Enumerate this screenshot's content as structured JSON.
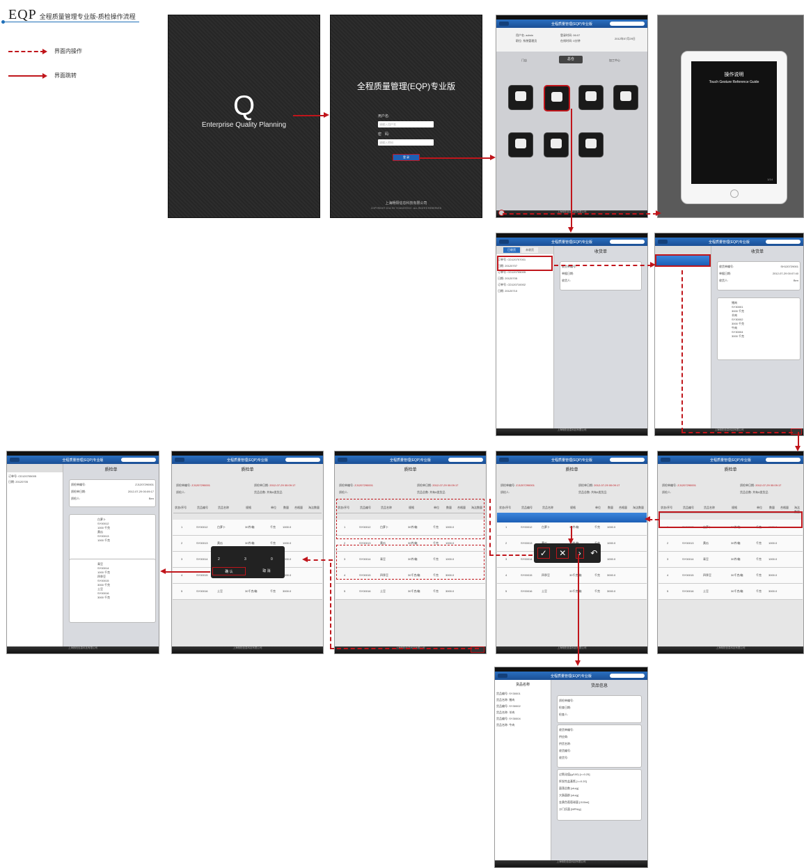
{
  "header": {
    "logo": "EQP",
    "subtitle": "全程质量管理专业版-质检操作流程"
  },
  "legend": {
    "dashed_label": "界面内操作",
    "solid_label": "界面跳转"
  },
  "splash": {
    "logo_letter": "Q",
    "product_name": "Enterprise Quality Planning"
  },
  "login": {
    "title": "全程质量管理(EQP)专业版",
    "username_label": "用户名:",
    "username_placeholder": "请输入用户名",
    "password_label": "密　码:",
    "password_placeholder": "请输入密码",
    "login_button": "登 录",
    "company": "上海畅阳信息科技有限公司",
    "copyright": "COPYRIGHT 2012 BY YOUNGTECH . ALL RIGHTS RESERVED"
  },
  "menu": {
    "nav_title": "全程质量管理(EQP)专业版",
    "user_label": "用户名: admin",
    "role_label": "职位: 系统管理员",
    "login_time": "登录时间: 06:07",
    "online_time": "在线时间: 0分钟",
    "date": "2012年07月29日",
    "tabs": [
      "门店",
      "总仓",
      "加工中心"
    ],
    "icons": [
      "收货",
      "质检",
      "入库",
      "申请退货",
      "退货处理",
      "分拣",
      "配送"
    ]
  },
  "guide": {
    "title": "操作说明",
    "subtitle": "Touch Gesture Reference Guide",
    "pager": "1/14"
  },
  "receipt": {
    "title": "收货单",
    "tab_done": "已收货",
    "tab_pending": "未收货",
    "orders": [
      {
        "no": "订单号:",
        "val": "CD120707001"
      },
      {
        "no": "日期:",
        "val": "20120707"
      },
      {
        "no": "订单号:",
        "val": "CD120705005"
      },
      {
        "no": "日期:",
        "val": "20120705"
      },
      {
        "no": "订单号:",
        "val": "CD120710002"
      },
      {
        "no": "日期:",
        "val": "20120710"
      }
    ],
    "form": [
      "收货单编号:",
      "单据日期:",
      "收货人:"
    ],
    "detail_no": "SH120729001",
    "detail_date": "2012-07-29 00:07:40",
    "detail_person": "Ben",
    "goods_section": "货品清单",
    "goods": [
      {
        "name": "猪肉",
        "code": "SY30001",
        "qty": "3000 千克"
      },
      {
        "name": "羊肉",
        "code": "SY30002",
        "qty": "3000 千克"
      },
      {
        "name": "牛肉",
        "code": "SY30004",
        "qty": "3000 千克"
      }
    ]
  },
  "qc": {
    "title": "质检单",
    "no_label": "质检单编号:",
    "no_value": "ZJ1207290001",
    "date_label": "质检单日期:",
    "date_value": "2012-07-29 00:09:17",
    "person_label": "质检人:",
    "total_label": "货品总数:",
    "total_value": "共有6类货品",
    "columns": [
      "状态/序号",
      "货品编号",
      "货品名称",
      "规格",
      "单位",
      "数量",
      "合格量",
      "淘汰数量"
    ],
    "rows": [
      {
        "idx": "1",
        "code": "SY00012",
        "name": "白萝卜",
        "spec": "30件/箱",
        "unit": "千克",
        "qty": "1000.0"
      },
      {
        "idx": "2",
        "code": "SY00013",
        "name": "黄瓜",
        "spec": "30件/箱",
        "unit": "千克",
        "qty": "1000.0"
      },
      {
        "idx": "3",
        "code": "SY00014",
        "name": "青豆",
        "spec": "30件/箱",
        "unit": "千克",
        "qty": "1000.0"
      },
      {
        "idx": "4",
        "code": "SY00015",
        "name": "四季豆",
        "spec": "30千克/箱",
        "unit": "千克",
        "qty": "3000.0"
      },
      {
        "idx": "5",
        "code": "SY00016",
        "name": "土豆",
        "spec": "30千克/箱",
        "unit": "千克",
        "qty": "3000.0"
      }
    ],
    "dialog_numbers": [
      "2",
      "3",
      "0"
    ],
    "confirm": "确 认",
    "cancel": "取 消",
    "summary_no": "ZJ1207290001",
    "summary_date": "2012-07-29 00:09:17",
    "summary_person": "Ben",
    "summary_order_no": "CD120705005",
    "summary_order_date": "20120705",
    "summary_goods": [
      {
        "name": "白萝卜",
        "code": "SY00012",
        "qty": "1000 千克"
      },
      {
        "name": "黄瓜",
        "code": "SY00013",
        "qty": "1000 千克"
      },
      {
        "name": "青豆",
        "code": "SY00014",
        "qty": "1000 千克"
      },
      {
        "name": "四季豆",
        "code": "SY00015",
        "qty": "3000 千克"
      },
      {
        "name": "土豆",
        "code": "SY00016",
        "qty": "3000 千克"
      }
    ]
  },
  "goodsinfo": {
    "left_title": "货品名称",
    "right_title": "货品信息",
    "items": [
      {
        "label": "货品编号:",
        "val": "SY30001"
      },
      {
        "label": "货品名称:",
        "val": "猪肉"
      },
      {
        "label": "货品编号:",
        "val": "SY30002"
      },
      {
        "label": "货品名称:",
        "val": "羊肉"
      },
      {
        "label": "货品编号:",
        "val": "SY30004"
      },
      {
        "label": "货品名称:",
        "val": "牛肉"
      }
    ],
    "form1": [
      "质检单编号:",
      "检查日期:",
      "检查人:"
    ],
    "form2": [
      "收货单编号:",
      "供应商:",
      "供货名称:",
      "收货编号:",
      "收货号:"
    ],
    "metrics": [
      "过氧化值(g/100) [<=0.25]",
      "挥发性盐基氮 [<=0.20]",
      "菌落总数 [cfu/g]",
      "大肠菌群 [cfu/g]",
      "金黄色葡萄球菌 [/100ml]",
      "沙门氏菌 [MPN/g]"
    ]
  },
  "actions": {
    "confirm_icon": "check-icon",
    "reject_icon": "cross-icon",
    "next_icon": "chevron-right-icon",
    "undo_icon": "undo-icon"
  }
}
